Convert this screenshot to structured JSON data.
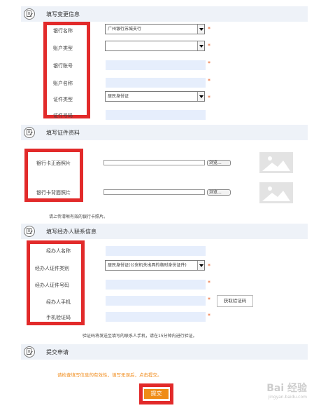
{
  "section1": {
    "title": "填写变更信息",
    "fields": [
      {
        "label": "银行名称",
        "type": "select",
        "value": "广州银行苏城支行"
      },
      {
        "label": "账户类型",
        "type": "select",
        "value": ""
      },
      {
        "label": "银行账号",
        "type": "input",
        "value": ""
      },
      {
        "label": "账户名称",
        "type": "input",
        "value": ""
      },
      {
        "label": "证件类型",
        "type": "select",
        "value": "居民身份证"
      },
      {
        "label": "证件号码",
        "type": "input",
        "value": ""
      }
    ]
  },
  "section2": {
    "title": "填写证件资料",
    "front_label": "银行卡正面照片",
    "back_label": "银行卡背面照片",
    "browse_label": "浏览...",
    "note": "请上传清晰有效的银行卡照片。"
  },
  "section3": {
    "title": "填写经办人联系信息",
    "fields": [
      {
        "label": "经办人名称",
        "type": "input",
        "value": ""
      },
      {
        "label": "经办人证件类别",
        "type": "select",
        "value": "居民身份证(公安机关出具的临时身份证件)"
      },
      {
        "label": "经办人证件号码",
        "type": "input",
        "value": ""
      },
      {
        "label": "经办人手机",
        "type": "input",
        "value": ""
      },
      {
        "label": "手机验证码",
        "type": "input",
        "value": ""
      }
    ],
    "get_code_label": "获取验证码",
    "note": "验证码将发送至填写的联系人手机，请在15分钟内进行验证。"
  },
  "section4": {
    "title": "提交申请",
    "note": "请检查填写信息的有效性，填写无误后，点击提交。",
    "submit_label": "提交"
  },
  "required_mark": "*",
  "watermark": {
    "text": "Bai 经验",
    "sub": "jingyan.baidu.com"
  },
  "colors": {
    "accent": "#ef8c16",
    "highlight": "#e22a2a",
    "field_bg": "#e6eefc",
    "header_bg": "#eef2f8",
    "required": "#e8581c"
  }
}
